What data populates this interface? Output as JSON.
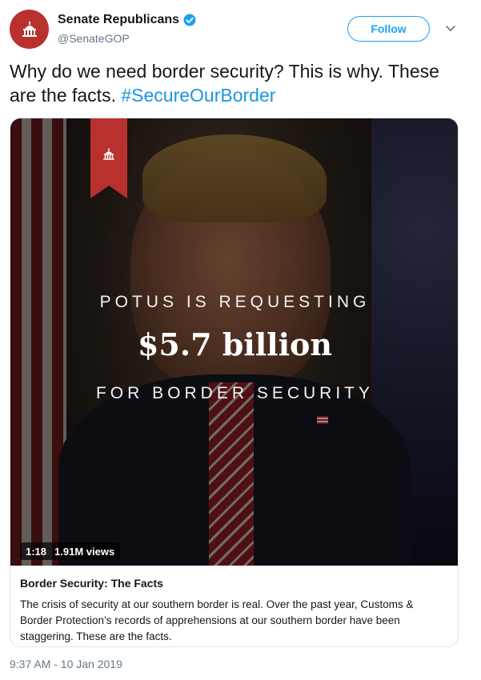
{
  "account": {
    "display_name": "Senate Republicans",
    "handle": "@SenateGOP",
    "verified": true,
    "avatar_icon": "capitol-icon",
    "avatar_color": "#b8312f"
  },
  "follow_button": {
    "label": "Follow"
  },
  "more_menu": {
    "icon": "chevron-down-icon"
  },
  "tweet": {
    "text": "Why do we need border security? This is why. These are the facts.",
    "hashtag": "#SecureOurBorder",
    "timestamp": "9:37 AM - 10 Jan 2019"
  },
  "video": {
    "overlay_line1": "POTUS IS REQUESTING",
    "overlay_amount": "$5.7 billion",
    "overlay_line3": "FOR BORDER SECURITY",
    "duration": "1:18",
    "views": "1.91M views",
    "ribbon_icon": "capitol-icon"
  },
  "card": {
    "title": "Border Security: The Facts",
    "description": "The crisis of security at our southern border is real. Over the past year, Customs & Border Protection’s records of apprehensions at our southern border have been staggering. These are the facts."
  },
  "colors": {
    "brand_red": "#b8312f",
    "twitter_blue": "#1da1f2",
    "link_blue": "#1b95e0",
    "secondary_text": "#657786"
  }
}
